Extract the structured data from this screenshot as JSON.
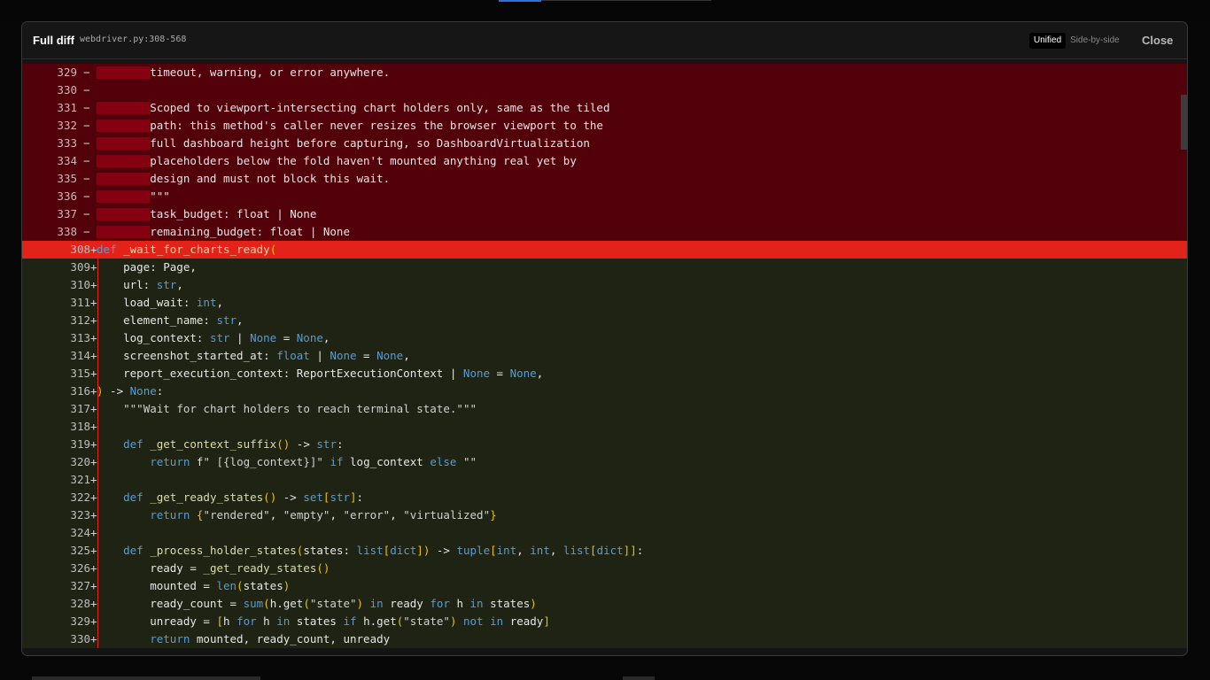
{
  "header": {
    "title": "Full diff",
    "file": "webdriver.py:308-568",
    "view_unified": "Unified",
    "view_side": "Side-by-side",
    "close": "Close"
  },
  "removed_lines": [
    {
      "num": "329",
      "marker": "−",
      "text": "        timeout, warning, or error anywhere."
    },
    {
      "num": "330",
      "marker": "−",
      "text": ""
    },
    {
      "num": "331",
      "marker": "−",
      "text": "        Scoped to viewport-intersecting chart holders only, same as the tiled"
    },
    {
      "num": "332",
      "marker": "−",
      "text": "        path: this method's caller never resizes the browser viewport to the"
    },
    {
      "num": "333",
      "marker": "−",
      "text": "        full dashboard height before capturing, so DashboardVirtualization"
    },
    {
      "num": "334",
      "marker": "−",
      "text": "        placeholders below the fold haven't mounted anything real yet by"
    },
    {
      "num": "335",
      "marker": "−",
      "text": "        design and must not block this wait."
    },
    {
      "num": "336",
      "marker": "−",
      "text": "        \"\"\""
    },
    {
      "num": "337",
      "marker": "−",
      "text": "        task_budget: float | None"
    },
    {
      "num": "338",
      "marker": "−",
      "text": "        remaining_budget: float | None"
    }
  ],
  "added_lines": [
    {
      "num": "308",
      "marker": "+",
      "text": "def _wait_for_charts_ready("
    },
    {
      "num": "309",
      "marker": "+",
      "text": "    page: Page,"
    },
    {
      "num": "310",
      "marker": "+",
      "text": "    url: str,"
    },
    {
      "num": "311",
      "marker": "+",
      "text": "    load_wait: int,"
    },
    {
      "num": "312",
      "marker": "+",
      "text": "    element_name: str,"
    },
    {
      "num": "313",
      "marker": "+",
      "text": "    log_context: str | None = None,"
    },
    {
      "num": "314",
      "marker": "+",
      "text": "    screenshot_started_at: float | None = None,"
    },
    {
      "num": "315",
      "marker": "+",
      "text": "    report_execution_context: ReportExecutionContext | None = None,"
    },
    {
      "num": "316",
      "marker": "+",
      "text": ") -> None:"
    },
    {
      "num": "317",
      "marker": "+",
      "text": "    \"\"\"Wait for chart holders to reach terminal state.\"\"\""
    },
    {
      "num": "318",
      "marker": "+",
      "text": ""
    },
    {
      "num": "319",
      "marker": "+",
      "text": "    def _get_context_suffix() -> str:"
    },
    {
      "num": "320",
      "marker": "+",
      "text": "        return f\" [{log_context}]\" if log_context else \"\""
    },
    {
      "num": "321",
      "marker": "+",
      "text": ""
    },
    {
      "num": "322",
      "marker": "+",
      "text": "    def _get_ready_states() -> set[str]:"
    },
    {
      "num": "323",
      "marker": "+",
      "text": "        return {\"rendered\", \"empty\", \"error\", \"virtualized\"}"
    },
    {
      "num": "324",
      "marker": "+",
      "text": ""
    },
    {
      "num": "325",
      "marker": "+",
      "text": "    def _process_holder_states(states: list[dict]) -> tuple[int, int, list[dict]]:"
    },
    {
      "num": "326",
      "marker": "+",
      "text": "        ready = _get_ready_states()"
    },
    {
      "num": "327",
      "marker": "+",
      "text": "        mounted = len(states)"
    },
    {
      "num": "328",
      "marker": "+",
      "text": "        ready_count = sum(h.get(\"state\") in ready for h in states)"
    },
    {
      "num": "329",
      "marker": "+",
      "text": "        unready = [h for h in states if h.get(\"state\") not in ready]"
    },
    {
      "num": "330",
      "marker": "+",
      "text": "        return mounted, ready_count, unready"
    }
  ],
  "colors": {
    "removed_bg": "#520009",
    "added_bg": "#1e2313",
    "highlight": "#e3231a",
    "keyword": "#569cd6",
    "function": "#dcdcaa",
    "bracket": "#f0c000"
  }
}
